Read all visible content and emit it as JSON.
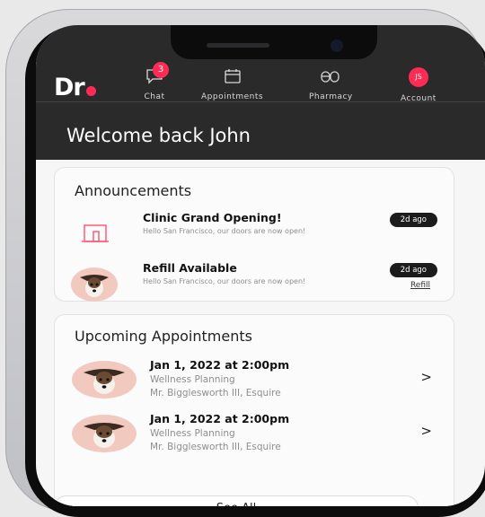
{
  "app": {
    "logo_text": "Dr",
    "brand_color": "#ff2b55"
  },
  "nav": {
    "chat": {
      "label": "Chat",
      "badge": "3",
      "icon": "chat-bubble-icon"
    },
    "appointments": {
      "label": "Appointments",
      "icon": "calendar-icon"
    },
    "pharmacy": {
      "label": "Pharmacy",
      "icon": "pills-icon"
    },
    "account": {
      "label": "Account",
      "initials": "JS",
      "icon": "avatar-icon"
    }
  },
  "welcome_text": "Welcome back John",
  "announcements": {
    "heading": "Announcements",
    "items": [
      {
        "title": "Clinic Grand Opening!",
        "desc": "Hello San Francisco, our doors are now open!",
        "time": "2d ago",
        "icon": "clinic-building-icon"
      },
      {
        "title": "Refill Available",
        "desc": "Hello San Francisco, our doors are now open!",
        "time": "2d ago",
        "action": "Refill",
        "icon": "dog-avatar-icon"
      }
    ]
  },
  "appointments": {
    "heading": "Upcoming Appointments",
    "items": [
      {
        "date": "Jan 1, 2022 at 2:00pm",
        "service": "Wellness Planning",
        "doctor": "Mr. Bigglesworth III, Esquire"
      },
      {
        "date": "Jan 1, 2022 at 2:00pm",
        "service": "Wellness Planning",
        "doctor": "Mr. Bigglesworth III, Esquire"
      }
    ],
    "see_all_label": "See All"
  }
}
